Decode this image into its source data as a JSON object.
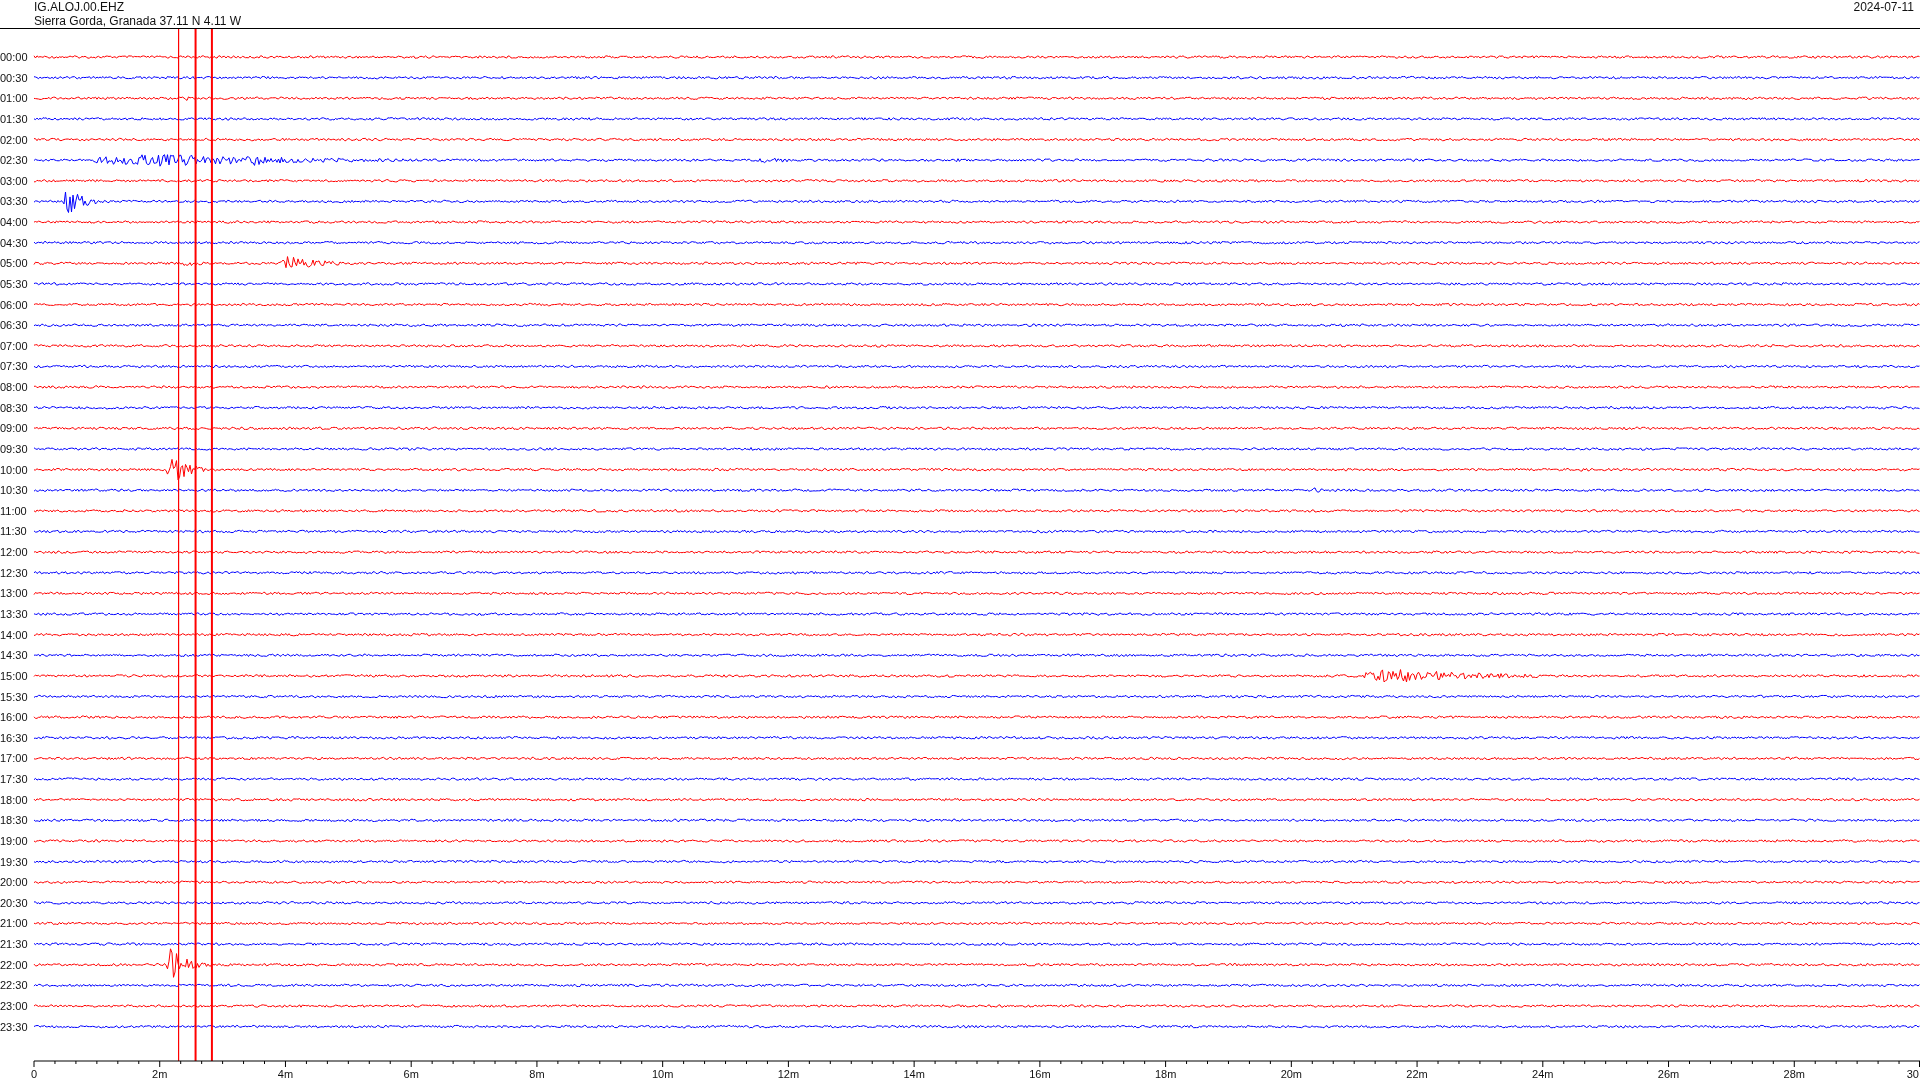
{
  "header": {
    "channel": "IG.ALOJ.00.EHZ",
    "location": "Sierra Gorda, Granada  37.11 N 4.11 W",
    "date": "2024-07-11"
  },
  "rows": [
    {
      "label": "00:00",
      "color": "#ff0000"
    },
    {
      "label": "00:30",
      "color": "#0000ff"
    },
    {
      "label": "01:00",
      "color": "#ff0000"
    },
    {
      "label": "01:30",
      "color": "#0000ff"
    },
    {
      "label": "02:00",
      "color": "#ff0000"
    },
    {
      "label": "02:30",
      "color": "#0000ff"
    },
    {
      "label": "03:00",
      "color": "#ff0000"
    },
    {
      "label": "03:30",
      "color": "#0000ff"
    },
    {
      "label": "04:00",
      "color": "#ff0000"
    },
    {
      "label": "04:30",
      "color": "#0000ff"
    },
    {
      "label": "05:00",
      "color": "#ff0000"
    },
    {
      "label": "05:30",
      "color": "#0000ff"
    },
    {
      "label": "06:00",
      "color": "#ff0000"
    },
    {
      "label": "06:30",
      "color": "#0000ff"
    },
    {
      "label": "07:00",
      "color": "#ff0000"
    },
    {
      "label": "07:30",
      "color": "#0000ff"
    },
    {
      "label": "08:00",
      "color": "#ff0000"
    },
    {
      "label": "08:30",
      "color": "#0000ff"
    },
    {
      "label": "09:00",
      "color": "#ff0000"
    },
    {
      "label": "09:30",
      "color": "#0000ff"
    },
    {
      "label": "10:00",
      "color": "#ff0000"
    },
    {
      "label": "10:30",
      "color": "#0000ff"
    },
    {
      "label": "11:00",
      "color": "#ff0000"
    },
    {
      "label": "11:30",
      "color": "#0000ff"
    },
    {
      "label": "12:00",
      "color": "#ff0000"
    },
    {
      "label": "12:30",
      "color": "#0000ff"
    },
    {
      "label": "13:00",
      "color": "#ff0000"
    },
    {
      "label": "13:30",
      "color": "#0000ff"
    },
    {
      "label": "14:00",
      "color": "#ff0000"
    },
    {
      "label": "14:30",
      "color": "#0000ff"
    },
    {
      "label": "15:00",
      "color": "#ff0000"
    },
    {
      "label": "15:30",
      "color": "#0000ff"
    },
    {
      "label": "16:00",
      "color": "#ff0000"
    },
    {
      "label": "16:30",
      "color": "#0000ff"
    },
    {
      "label": "17:00",
      "color": "#ff0000"
    },
    {
      "label": "17:30",
      "color": "#0000ff"
    },
    {
      "label": "18:00",
      "color": "#ff0000"
    },
    {
      "label": "18:30",
      "color": "#0000ff"
    },
    {
      "label": "19:00",
      "color": "#ff0000"
    },
    {
      "label": "19:30",
      "color": "#0000ff"
    },
    {
      "label": "20:00",
      "color": "#ff0000"
    },
    {
      "label": "20:30",
      "color": "#0000ff"
    },
    {
      "label": "21:00",
      "color": "#ff0000"
    },
    {
      "label": "21:30",
      "color": "#0000ff"
    },
    {
      "label": "22:00",
      "color": "#ff0000"
    },
    {
      "label": "22:30",
      "color": "#0000ff"
    },
    {
      "label": "23:00",
      "color": "#ff0000"
    },
    {
      "label": "23:30",
      "color": "#0000ff"
    }
  ],
  "x_axis": {
    "labels": [
      "0",
      "2m",
      "4m",
      "6m",
      "8m",
      "10m",
      "12m",
      "14m",
      "16m",
      "18m",
      "20m",
      "22m",
      "24m",
      "26m",
      "28m",
      "30"
    ]
  }
}
